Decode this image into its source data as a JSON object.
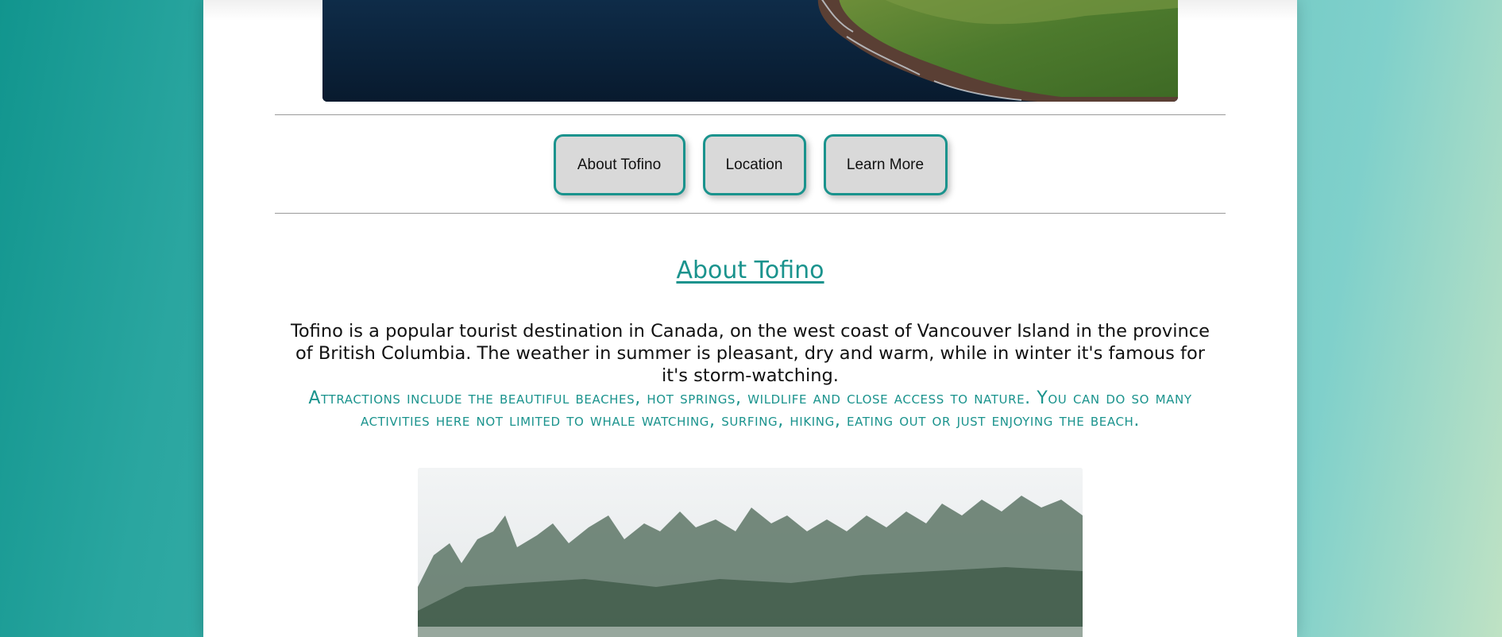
{
  "nav": {
    "items": [
      {
        "label": "About Tofino"
      },
      {
        "label": "Location"
      },
      {
        "label": "Learn More"
      }
    ]
  },
  "about": {
    "title": "About Tofino",
    "intro": "Tofino is a popular tourist destination in Canada, on the west coast of Vancouver Island in the province of British Columbia. The weather in summer is pleasant, dry and warm, while in winter it's famous for it's storm-watching.",
    "attractions": "Attractions include the beautiful beaches, hot springs, wildlife and close access to nature. You can do so many activities here not limited to whale watching, surfing, hiking, eating out or just enjoying the beach."
  },
  "colors": {
    "accent": "#1a938d",
    "button_bg": "#d9d9d9",
    "page_bg": "#ffffff"
  }
}
